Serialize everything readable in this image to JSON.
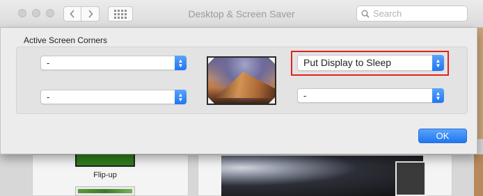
{
  "window": {
    "title": "Desktop & Screen Saver"
  },
  "toolbar": {
    "back_icon": "chevron-left-icon",
    "forward_icon": "chevron-right-icon",
    "show_all_icon": "grid-icon",
    "search_placeholder": "Search"
  },
  "sheet": {
    "group_title": "Active Screen Corners",
    "corners": {
      "top_left": "-",
      "bottom_left": "-",
      "top_right": "Put Display to Sleep",
      "bottom_right": "-"
    },
    "ok_label": "OK"
  },
  "background": {
    "flip_caption": "Flip-up"
  },
  "colors": {
    "accent": "#1f76f2",
    "highlight": "#e2211c"
  }
}
